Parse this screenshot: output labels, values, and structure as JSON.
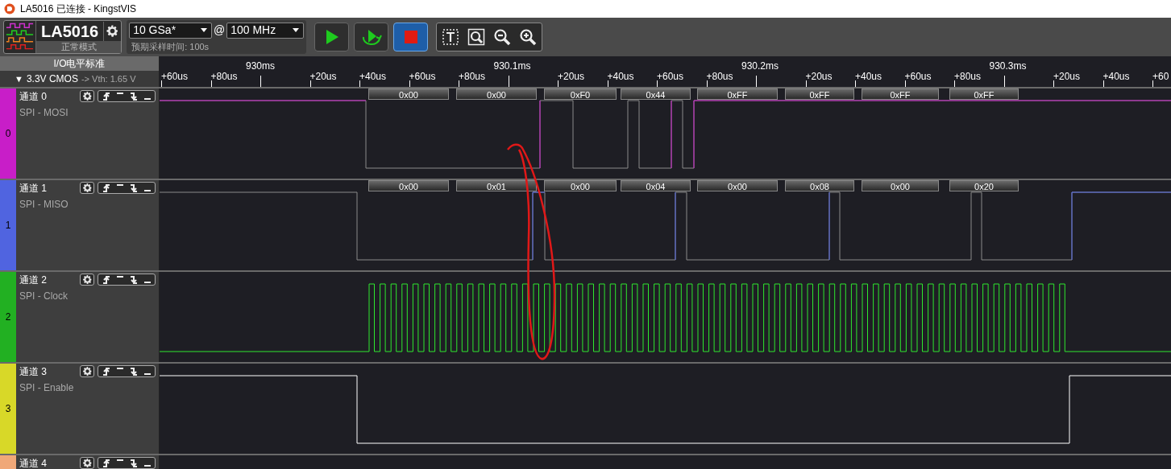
{
  "window": {
    "title": "LA5016 已连接 - KingstVIS"
  },
  "device": {
    "name": "LA5016",
    "mode": "正常模式"
  },
  "sampling": {
    "depth": "10 GSa*",
    "at": "@",
    "rate": "100 MHz",
    "expected_time": "预期采样时间: 100s"
  },
  "run_controls": [
    {
      "kind": "start",
      "selected": false
    },
    {
      "kind": "loop",
      "selected": false
    },
    {
      "kind": "stop",
      "selected": true
    }
  ],
  "tools": [
    {
      "kind": "select"
    },
    {
      "kind": "zoom-box"
    },
    {
      "kind": "zoom-out"
    },
    {
      "kind": "zoom-in"
    }
  ],
  "io_standard": {
    "title": "I/O电平标准",
    "arrow": "▼",
    "value": "3.3V CMOS",
    "threshold": "-> Vth: 1.65 V"
  },
  "ruler": {
    "ticks": [
      {
        "label": "+60us",
        "kind": "minor"
      },
      {
        "label": "+80us",
        "kind": "minor"
      },
      {
        "label": "930ms",
        "kind": "major"
      },
      {
        "label": "+20us",
        "kind": "minor"
      },
      {
        "label": "+40us",
        "kind": "minor"
      },
      {
        "label": "+60us",
        "kind": "minor"
      },
      {
        "label": "+80us",
        "kind": "minor"
      },
      {
        "label": "930.1ms",
        "kind": "major"
      },
      {
        "label": "+20us",
        "kind": "minor"
      },
      {
        "label": "+40us",
        "kind": "minor"
      },
      {
        "label": "+60us",
        "kind": "minor"
      },
      {
        "label": "+80us",
        "kind": "minor"
      },
      {
        "label": "930.2ms",
        "kind": "major"
      },
      {
        "label": "+20us",
        "kind": "minor"
      },
      {
        "label": "+40us",
        "kind": "minor"
      },
      {
        "label": "+60us",
        "kind": "minor"
      },
      {
        "label": "+80us",
        "kind": "minor"
      },
      {
        "label": "930.3ms",
        "kind": "major"
      },
      {
        "label": "+20us",
        "kind": "minor"
      },
      {
        "label": "+40us",
        "kind": "minor"
      },
      {
        "label": "+60",
        "kind": "minor"
      }
    ]
  },
  "channels": [
    {
      "index": "0",
      "name": "通道 0",
      "protocol": "SPI - MOSI",
      "color": "#c81ec8",
      "decoded": [
        "0x00",
        "0x00",
        "0xF0",
        "0x44",
        "0xFF",
        "0xFF",
        "0xFF",
        "0xFF"
      ]
    },
    {
      "index": "1",
      "name": "通道 1",
      "protocol": "SPI - MISO",
      "color": "#5064e0",
      "decoded": [
        "0x00",
        "0x01",
        "0x00",
        "0x04",
        "0x00",
        "0x08",
        "0x00",
        "0x20"
      ]
    },
    {
      "index": "2",
      "name": "通道 2",
      "protocol": "SPI - Clock",
      "color": "#22b022"
    },
    {
      "index": "3",
      "name": "通道 3",
      "protocol": "SPI - Enable",
      "color": "#d8d828"
    },
    {
      "name": "通道 4",
      "color": "#f0a878"
    }
  ]
}
